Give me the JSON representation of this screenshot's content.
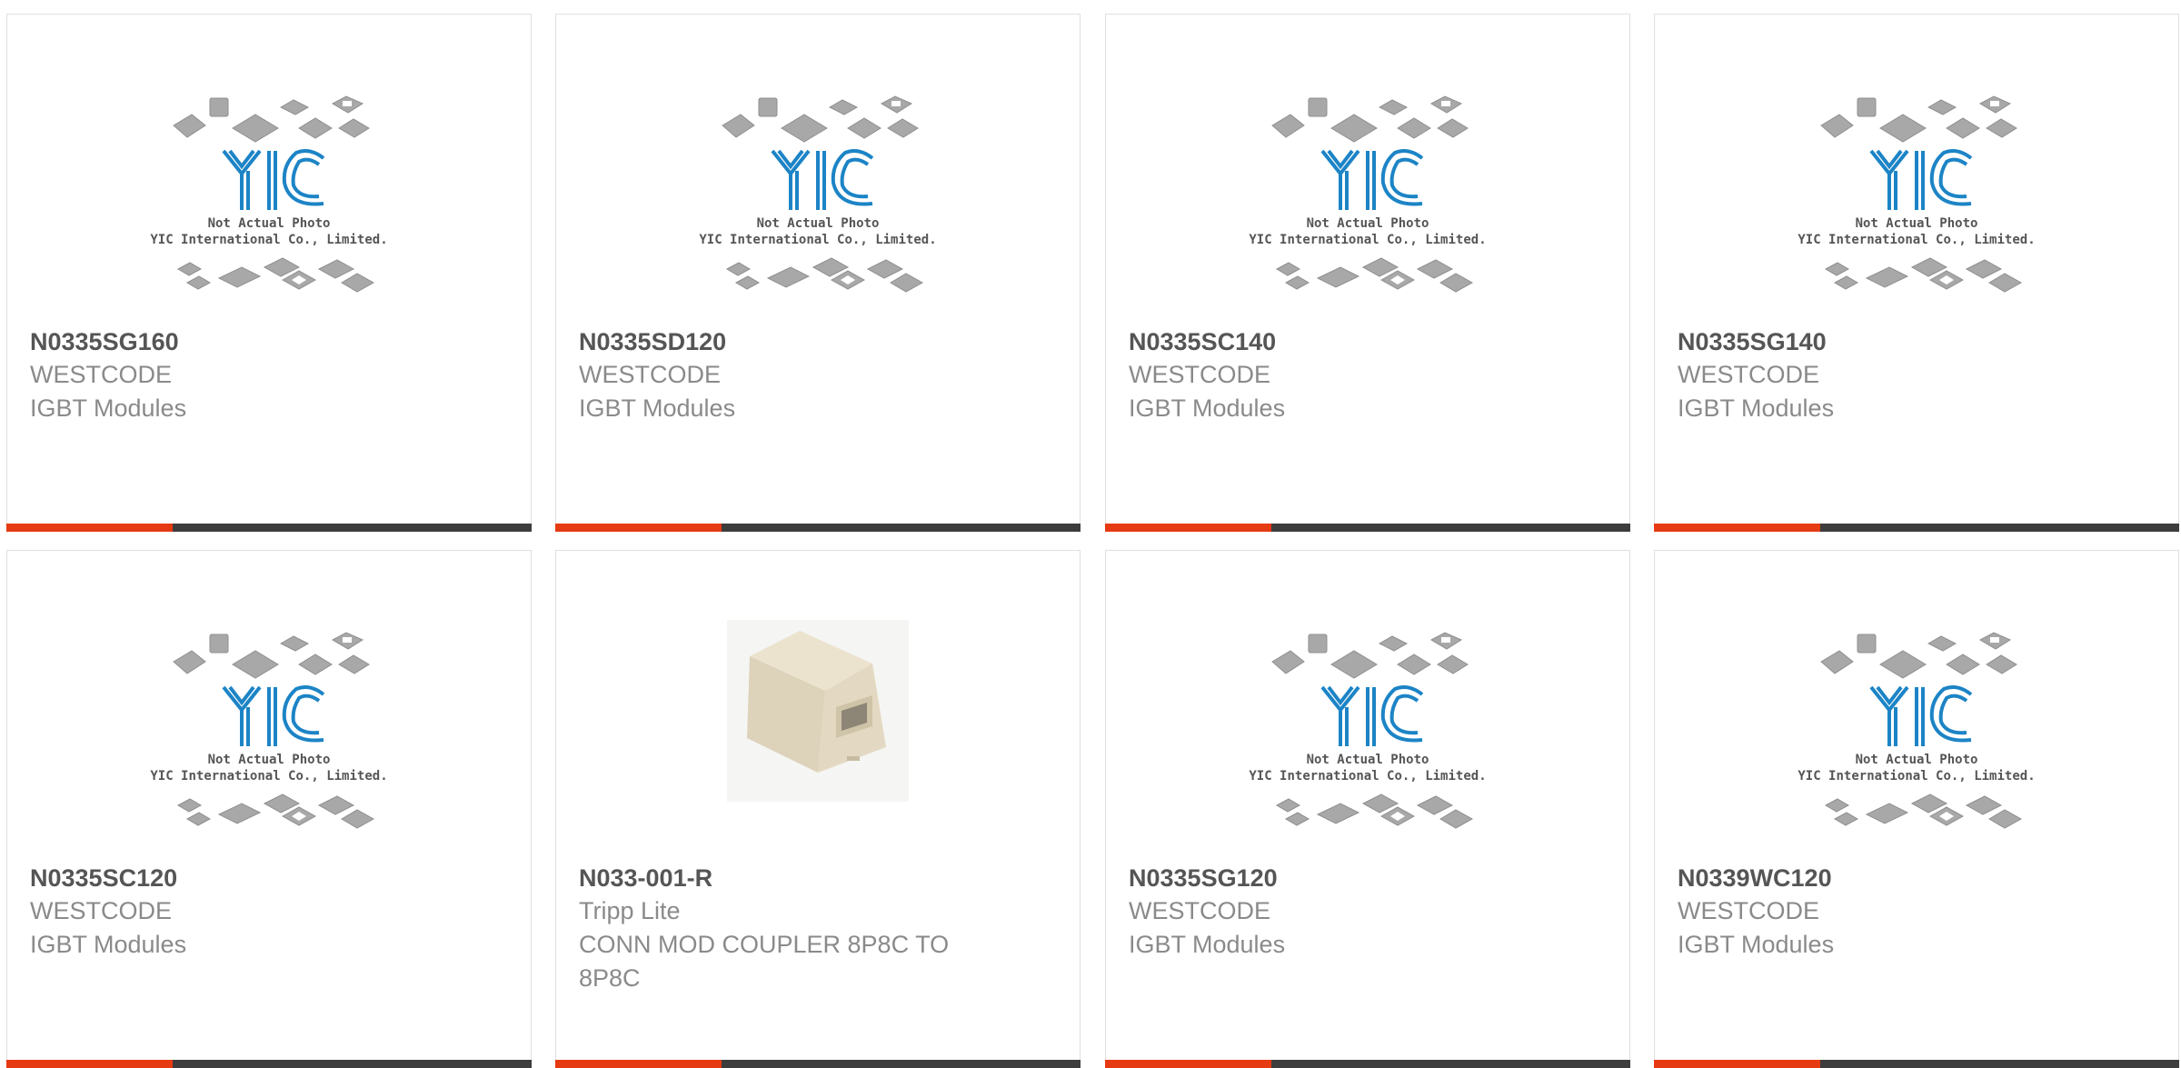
{
  "theme": {
    "accent": "#e63a12",
    "bar": "#3d3d3d",
    "logo_blue": "#1c84c6"
  },
  "placeholder": {
    "line1": "Not Actual Photo",
    "line2": "YIC International Co., Limited.",
    "logo_text": "YIC"
  },
  "products": [
    {
      "part_number": "N0335SG160",
      "manufacturer": "WESTCODE",
      "description": "IGBT Modules",
      "image": "placeholder"
    },
    {
      "part_number": "N0335SD120",
      "manufacturer": "WESTCODE",
      "description": "IGBT Modules",
      "image": "placeholder"
    },
    {
      "part_number": "N0335SC140",
      "manufacturer": "WESTCODE",
      "description": "IGBT Modules",
      "image": "placeholder"
    },
    {
      "part_number": "N0335SG140",
      "manufacturer": "WESTCODE",
      "description": "IGBT Modules",
      "image": "placeholder"
    },
    {
      "part_number": "N0335SC120",
      "manufacturer": "WESTCODE",
      "description": "IGBT Modules",
      "image": "placeholder"
    },
    {
      "part_number": "N033-001-R",
      "manufacturer": "Tripp Lite",
      "description": "CONN MOD COUPLER 8P8C TO 8P8C",
      "image": "coupler-photo"
    },
    {
      "part_number": "N0335SG120",
      "manufacturer": "WESTCODE",
      "description": "IGBT Modules",
      "image": "placeholder"
    },
    {
      "part_number": "N0339WC120",
      "manufacturer": "WESTCODE",
      "description": "IGBT Modules",
      "image": "placeholder"
    }
  ]
}
